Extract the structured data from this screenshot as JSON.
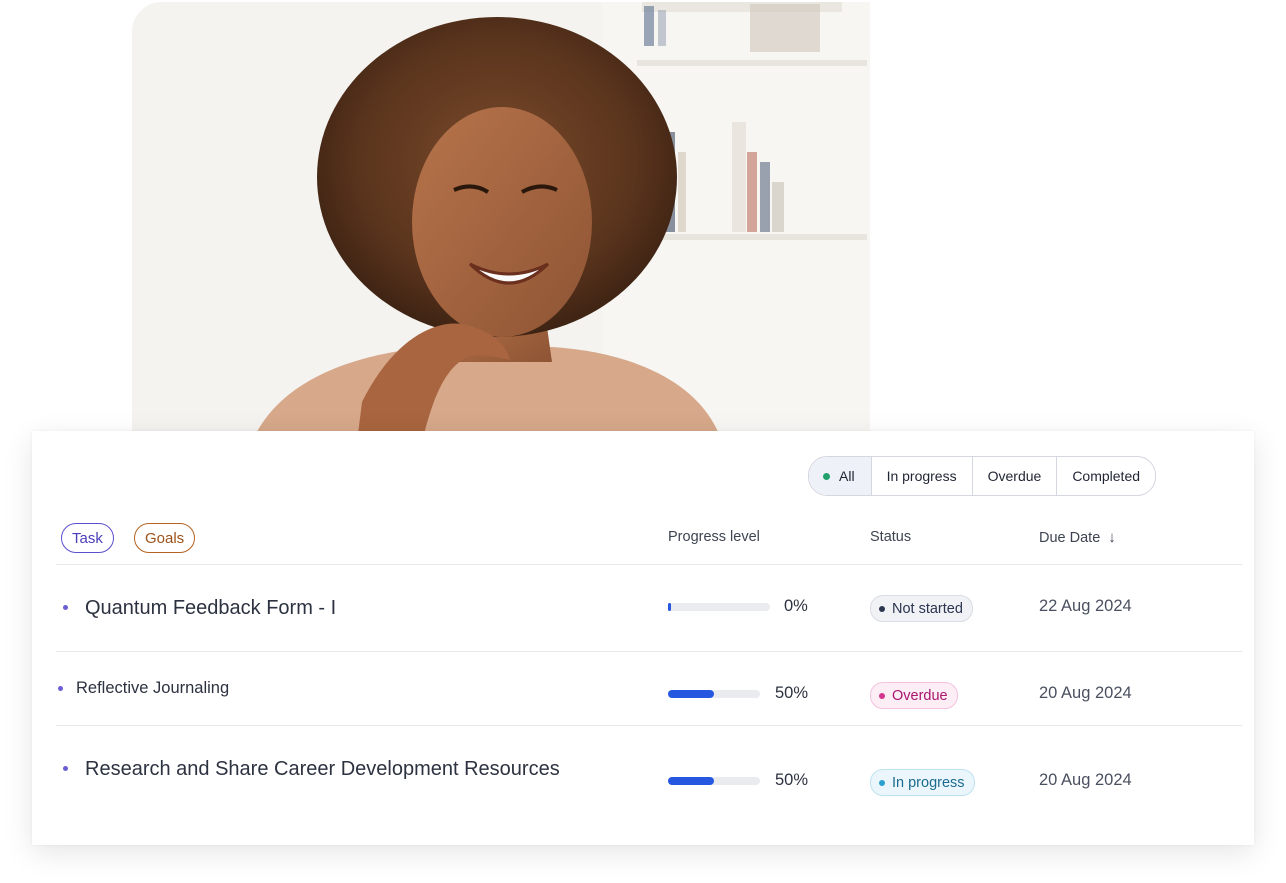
{
  "filters": {
    "all": "All",
    "in_progress": "In progress",
    "overdue": "Overdue",
    "completed": "Completed"
  },
  "chips": {
    "task": "Task",
    "goals": "Goals"
  },
  "columns": {
    "progress": "Progress level",
    "status": "Status",
    "due_date": "Due Date",
    "sort_icon": "arrow-down-icon"
  },
  "rows": [
    {
      "name": "Quantum Feedback Form - I",
      "progress": 0,
      "progress_label": "0%",
      "status": "Not started",
      "due": "22 Aug 2024"
    },
    {
      "name": "Reflective Journaling",
      "progress": 50,
      "progress_label": "50%",
      "status": "Overdue",
      "due": "20 Aug 2024"
    },
    {
      "name": "Research and Share Career Development Resources",
      "progress": 50,
      "progress_label": "50%",
      "status": "In progress",
      "due": "20 Aug 2024"
    }
  ],
  "colors": {
    "accent": "#2657e0",
    "task_chip": "#5b4fcf",
    "goals_chip": "#b4621f",
    "overdue": "#d2358c",
    "in_progress": "#2aa0cf",
    "all_dot": "#22a06b"
  }
}
